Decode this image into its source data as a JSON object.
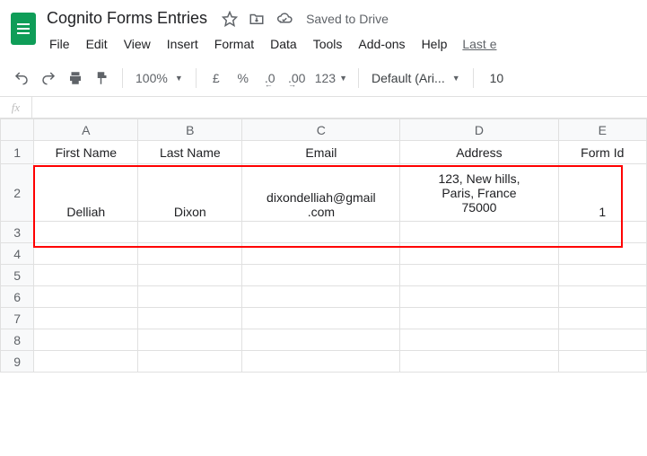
{
  "doc": {
    "title": "Cognito Forms Entries",
    "saved": "Saved to Drive"
  },
  "menu": {
    "file": "File",
    "edit": "Edit",
    "view": "View",
    "insert": "Insert",
    "format": "Format",
    "data": "Data",
    "tools": "Tools",
    "addons": "Add-ons",
    "help": "Help",
    "last": "Last e"
  },
  "toolbar": {
    "zoom": "100%",
    "currency": "£",
    "percent": "%",
    "dec_dec": ".0",
    "dec_inc": ".00",
    "numfmt": "123",
    "font": "Default (Ari...",
    "fontsize": "10"
  },
  "fx": {
    "label": "fx",
    "value": ""
  },
  "columns": {
    "A": "A",
    "B": "B",
    "C": "C",
    "D": "D",
    "E": "E"
  },
  "rows": {
    "r1": "1",
    "r2": "2",
    "r3": "3",
    "r4": "4",
    "r5": "5",
    "r6": "6",
    "r7": "7",
    "r8": "8",
    "r9": "9"
  },
  "headers": {
    "a": "First Name",
    "b": "Last Name",
    "c": "Email",
    "d": "Address",
    "e": "Form Id"
  },
  "data": {
    "a": "Delliah",
    "b": "Dixon",
    "c": "dixondelliah@gmail\n.com",
    "d": "123, New hills,\nParis, France\n75000",
    "e": "1"
  }
}
